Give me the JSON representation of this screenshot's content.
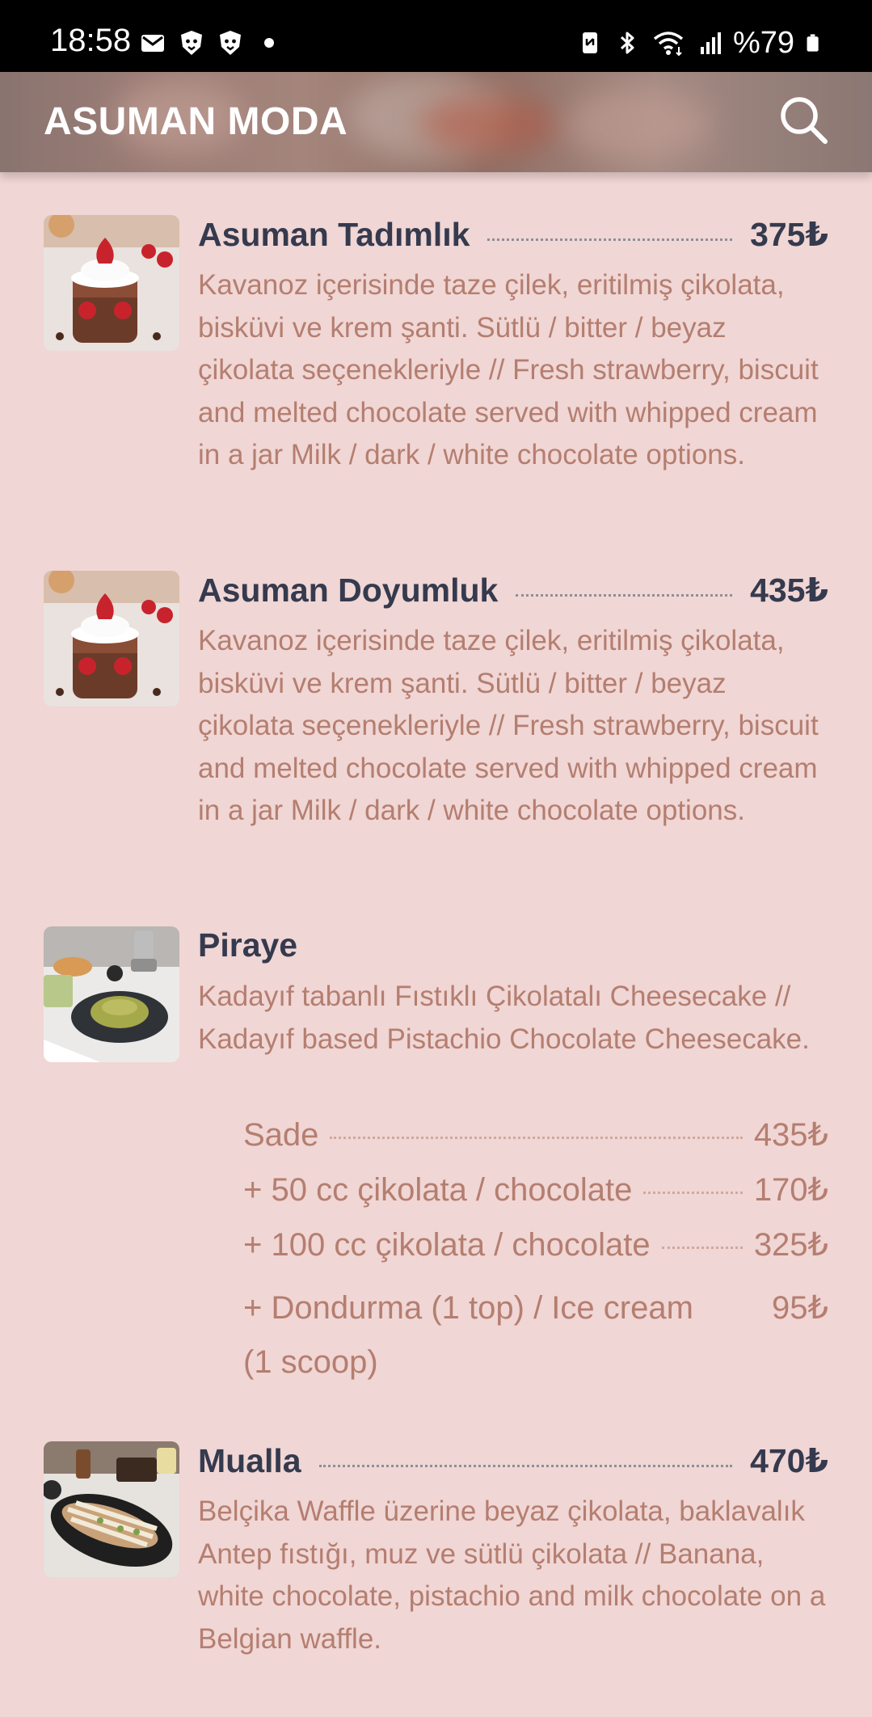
{
  "status_bar": {
    "time": "18:58",
    "battery": "%79",
    "icons_left": [
      "mail-icon",
      "lion-shield-icon",
      "lion-shield-icon",
      "dot-icon"
    ],
    "icons_right": [
      "nfc-icon",
      "bluetooth-icon",
      "wifi-icon",
      "signal-icon",
      "battery-icon"
    ]
  },
  "app_bar": {
    "title": "ASUMAN MODA",
    "search_icon": "search-icon"
  },
  "items": [
    {
      "name": "Asuman Tadımlık",
      "price": "375₺",
      "description": "Kavanoz içerisinde taze çilek, eritilmiş çikolata, bisküvi ve krem şanti. Sütlü / bitter / beyaz çikolata seçenekleriyle // Fresh strawberry, biscuit and melted chocolate served with whipped cream in a jar Milk / dark / white chocolate options."
    },
    {
      "name": "Asuman Doyumluk",
      "price": "435₺",
      "description": "Kavanoz içerisinde taze çilek, eritilmiş çikolata, bisküvi ve krem şanti. Sütlü / bitter / beyaz çikolata seçenekleriyle // Fresh strawberry, biscuit and melted chocolate served with whipped cream in a jar Milk / dark / white chocolate options."
    },
    {
      "name": "Piraye",
      "description": "Kadayıf tabanlı Fıstıklı Çikolatalı Cheesecake // Kadayıf based Pistachio Chocolate Cheesecake.",
      "options": [
        {
          "label": "Sade",
          "price": "435₺"
        },
        {
          "label": "+ 50 cc çikolata / chocolate",
          "price": "170₺"
        },
        {
          "label": "+ 100 cc çikolata / chocolate",
          "price": "325₺"
        },
        {
          "label": "+ Dondurma (1 top) / Ice cream (1 scoop)",
          "price": "95₺"
        }
      ]
    },
    {
      "name": "Mualla",
      "price": "470₺",
      "description": "Belçika Waffle üzerine beyaz çikolata, baklavalık Antep fıstığı, muz ve sütlü çikolata // Banana, white chocolate, pistachio and milk chocolate on a Belgian waffle."
    }
  ],
  "colors": {
    "background": "#f0d6d4",
    "title_text": "#353a4e",
    "description_text": "#b47e70"
  }
}
